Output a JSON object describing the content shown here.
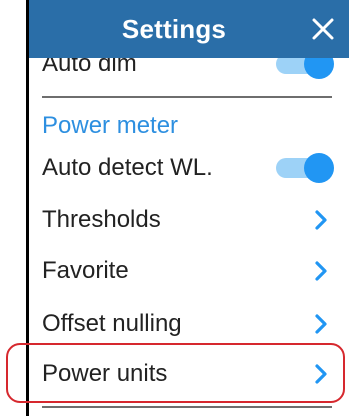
{
  "header": {
    "title": "Settings",
    "close_icon": "close-icon"
  },
  "settings": {
    "partial_item_label": "Auto dim",
    "partial_item_toggle_on": true,
    "section_title": "Power meter",
    "auto_detect_label": "Auto detect WL.",
    "auto_detect_on": true,
    "items": [
      {
        "label": "Thresholds",
        "icon": "chevron-right-icon"
      },
      {
        "label": "Favorite",
        "icon": "chevron-right-icon"
      },
      {
        "label": "Offset nulling",
        "icon": "chevron-right-icon"
      },
      {
        "label": "Power units",
        "icon": "chevron-right-icon"
      }
    ]
  },
  "colors": {
    "header_bg": "#2a6ea8",
    "accent": "#2196f3",
    "section_text": "#2d8fe0",
    "highlight_outline": "#d6282e"
  }
}
